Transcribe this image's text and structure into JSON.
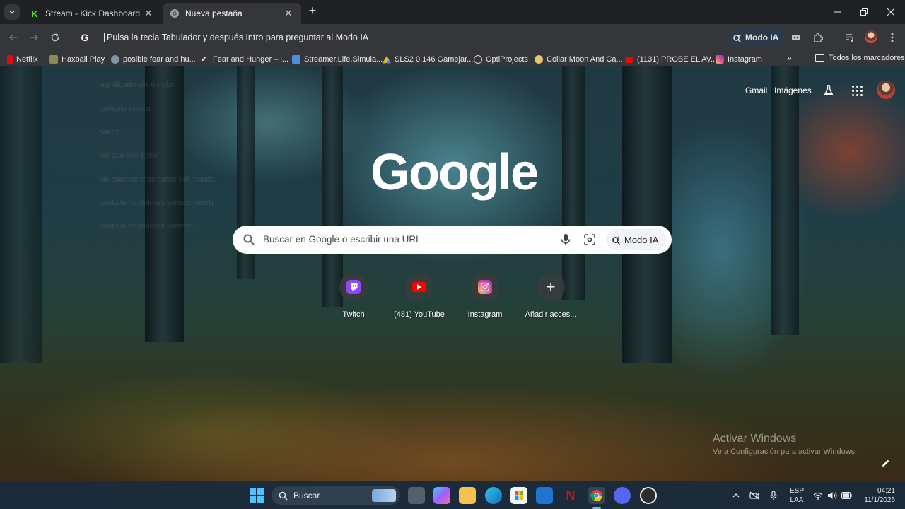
{
  "tabs": [
    {
      "title": "Stream - Kick Dashboard",
      "favicon": "kick-icon",
      "active": false
    },
    {
      "title": "Nueva pestaña",
      "favicon": "chrome-icon",
      "active": true
    }
  ],
  "omnibox": {
    "hint": "Pulsa la tecla Tabulador y después Intro para preguntar al Modo IA",
    "ai_label": "Modo IA"
  },
  "bookmarks": [
    {
      "label": "Netflix",
      "icon": "netflix-icon",
      "color": "#e50914"
    },
    {
      "label": "Haxball Play",
      "icon": "haxball-icon",
      "color": "#8a8a55"
    },
    {
      "label": "posible fear and hu...",
      "icon": "globe-icon",
      "color": "#7a9aa0"
    },
    {
      "label": "Fear and Hunger – l...",
      "icon": "feather-icon",
      "color": "#e8eaed"
    },
    {
      "label": "Streamer.Life.Simula...",
      "icon": "page-icon",
      "color": "#4f8de0"
    },
    {
      "label": "SLS2 0.146 Gamejar...",
      "icon": "drive-icon",
      "color": "#f4b400"
    },
    {
      "label": "OptiProjects",
      "icon": "opti-icon",
      "color": "#d8d8d8"
    },
    {
      "label": "Collar Moon And Ca...",
      "icon": "moon-icon",
      "color": "#e6c46a"
    },
    {
      "label": "(1131) PROBE EL AV...",
      "icon": "youtube-icon",
      "color": "#ff0000"
    },
    {
      "label": "Instagram",
      "icon": "instagram-icon",
      "color": "#d6249f"
    }
  ],
  "bookmarks_all": "Todos los marcadores",
  "ntp": {
    "links": {
      "gmail": "Gmail",
      "images": "Imágenes"
    },
    "search_placeholder": "Buscar en Google o escribir una URL",
    "ai_button": "Modo IA",
    "shortcuts": [
      {
        "label": "Twitch",
        "icon": "twitch-icon",
        "color": "#9146ff"
      },
      {
        "label": "(481) YouTube",
        "icon": "youtube-icon",
        "color": "#ff0000"
      },
      {
        "label": "Instagram",
        "icon": "instagram-icon",
        "color": "#d6249f"
      },
      {
        "label": "Añadir acces...",
        "icon": "plus-icon",
        "color": "#ffffff"
      }
    ],
    "ghost_history": [
      "significado sirr en obs",
      "pañuelo marca",
      "saeda",
      "tus que ses julsic",
      "los cuervos mas caros del mundo",
      "pantalla de dolores sorteno urerb",
      "pantalla de dolores sorteno"
    ]
  },
  "watermark": {
    "title": "Activar Windows",
    "subtitle": "Ve a Configuración para activar Windows."
  },
  "taskbar": {
    "search_label": "Buscar",
    "lang": [
      "ESP",
      "LAA"
    ],
    "time": "04:21",
    "date": "11/1/2026"
  }
}
